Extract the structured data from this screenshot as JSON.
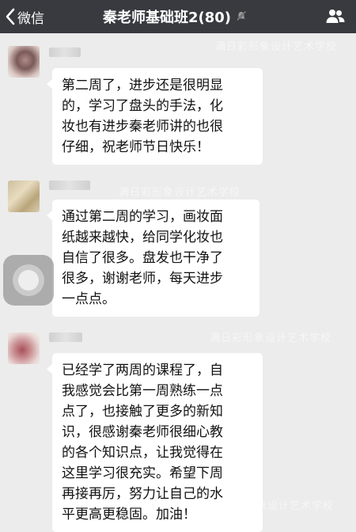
{
  "navbar": {
    "back_label": "微信",
    "title": "秦老师基础班2(80)",
    "back_icon": "chevron-left-icon",
    "mute_icon": "bell-muted-icon",
    "contacts_icon": "group-contacts-icon"
  },
  "watermark": {
    "text": "满日彩形象设计艺术学校"
  },
  "messages": [
    {
      "avatar": "avatar-photo",
      "text": "第二周了，进步还是很明显\n的，学习了盘头的手法，化\n妆也有进步秦老师讲的也很\n仔细，祝老师节日快乐！"
    },
    {
      "avatar": "avatar-photo",
      "text": "通过第二周的学习，画妆面\n纸越来越快，给同学化妆也\n自信了很多。盘发也干净了\n很多，谢谢老师，每天进步\n一点点。"
    },
    {
      "avatar": "avatar-photo",
      "text": "已经学了两周的课程了，自\n我感觉会比第一周熟练一点\n点了，也接触了更多的新知\n识，很感谢秦老师很细心教\n的各个知识点，让我觉得在\n这里学习很充实。希望下周\n再接再厉，努力让自己的水\n平更高更稳固。加油！"
    }
  ],
  "assistive_touch": {
    "icon": "assistive-touch-icon"
  },
  "colors": {
    "navbar_bg": "#393a3f",
    "chat_bg": "#ececec",
    "bubble_bg": "#ffffff"
  }
}
